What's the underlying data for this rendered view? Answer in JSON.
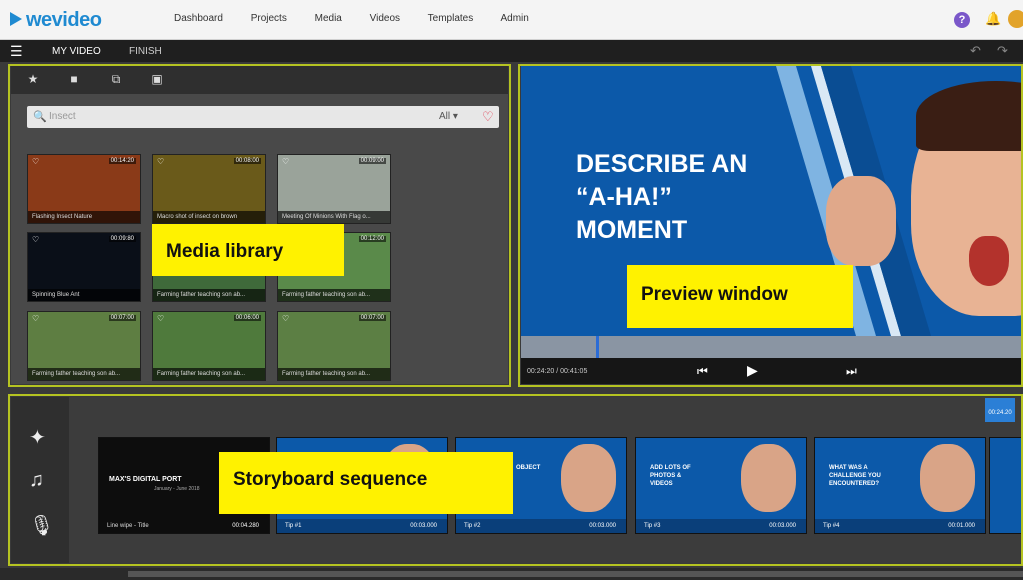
{
  "app": {
    "logo": "wevideo",
    "nav": [
      "Dashboard",
      "Projects",
      "Media",
      "Videos",
      "Templates",
      "Admin"
    ],
    "help_icon": "?"
  },
  "editor": {
    "tab_myvideo": "MY VIDEO",
    "tab_finish": "FINISH"
  },
  "library": {
    "search_placeholder": "Insect",
    "filter": "All ▾",
    "thumbs": [
      {
        "caption": "Flashing Insect Nature",
        "duration": "00:14:20",
        "color": "#8a3a18"
      },
      {
        "caption": "Macro shot of insect on brown",
        "duration": "00:08:00",
        "color": "#6a5a1a"
      },
      {
        "caption": "Meeting Of Minions With Flag o...",
        "duration": "00:09:00",
        "color": "#9aa39a"
      },
      {
        "caption": "Spinning Blue Ant",
        "duration": "00:09:80",
        "color": "#0a0f18"
      },
      {
        "caption": "Farming father teaching son ab...",
        "duration": "",
        "color": "#3f6a3a"
      },
      {
        "caption": "Farming father teaching son ab...",
        "duration": "00:12:00",
        "color": "#5a8a4a"
      },
      {
        "caption": "Farming father teaching son ab...",
        "duration": "00:07:00",
        "color": "#5e7e42"
      },
      {
        "caption": "Farming father teaching son ab...",
        "duration": "00:06:00",
        "color": "#4f7a3c"
      },
      {
        "caption": "Farming father teaching son ab...",
        "duration": "00:07:00",
        "color": "#5c7f44"
      }
    ]
  },
  "preview": {
    "text": "DESCRIBE AN\n“A-HA!”\nMOMENT",
    "timecode": "00:24:20 / 00:41:05",
    "progress": 0.15
  },
  "storyboard": {
    "title_clip": {
      "title": "MAX'S DIGITAL PORT",
      "subtitle": "January - June 2018",
      "caption": "Line wipe - Title",
      "duration": "00:04.280"
    },
    "clips": [
      {
        "text": "",
        "caption": "Tip #1",
        "duration": "00:03.000"
      },
      {
        "text": "OBJECT",
        "caption": "Tip #2",
        "duration": "00:03.000"
      },
      {
        "text": "ADD LOTS OF\nPHOTOS &\nVIDEOS",
        "caption": "Tip #3",
        "duration": "00:03.000"
      },
      {
        "text": "WHAT WAS A\nCHALLENGE YOU\nENCOUNTERED?",
        "caption": "Tip #4",
        "duration": "00:01.000"
      }
    ],
    "playhead_time": "00:24.20"
  },
  "annotations": {
    "media_library": "Media library",
    "preview_window": "Preview window",
    "storyboard_sequence": "Storyboard sequence"
  },
  "colors": {
    "outline": "#b5c321",
    "label_bg": "#fff200",
    "brand": "#1f8ad1",
    "preview_bg": "#0c59a9"
  }
}
